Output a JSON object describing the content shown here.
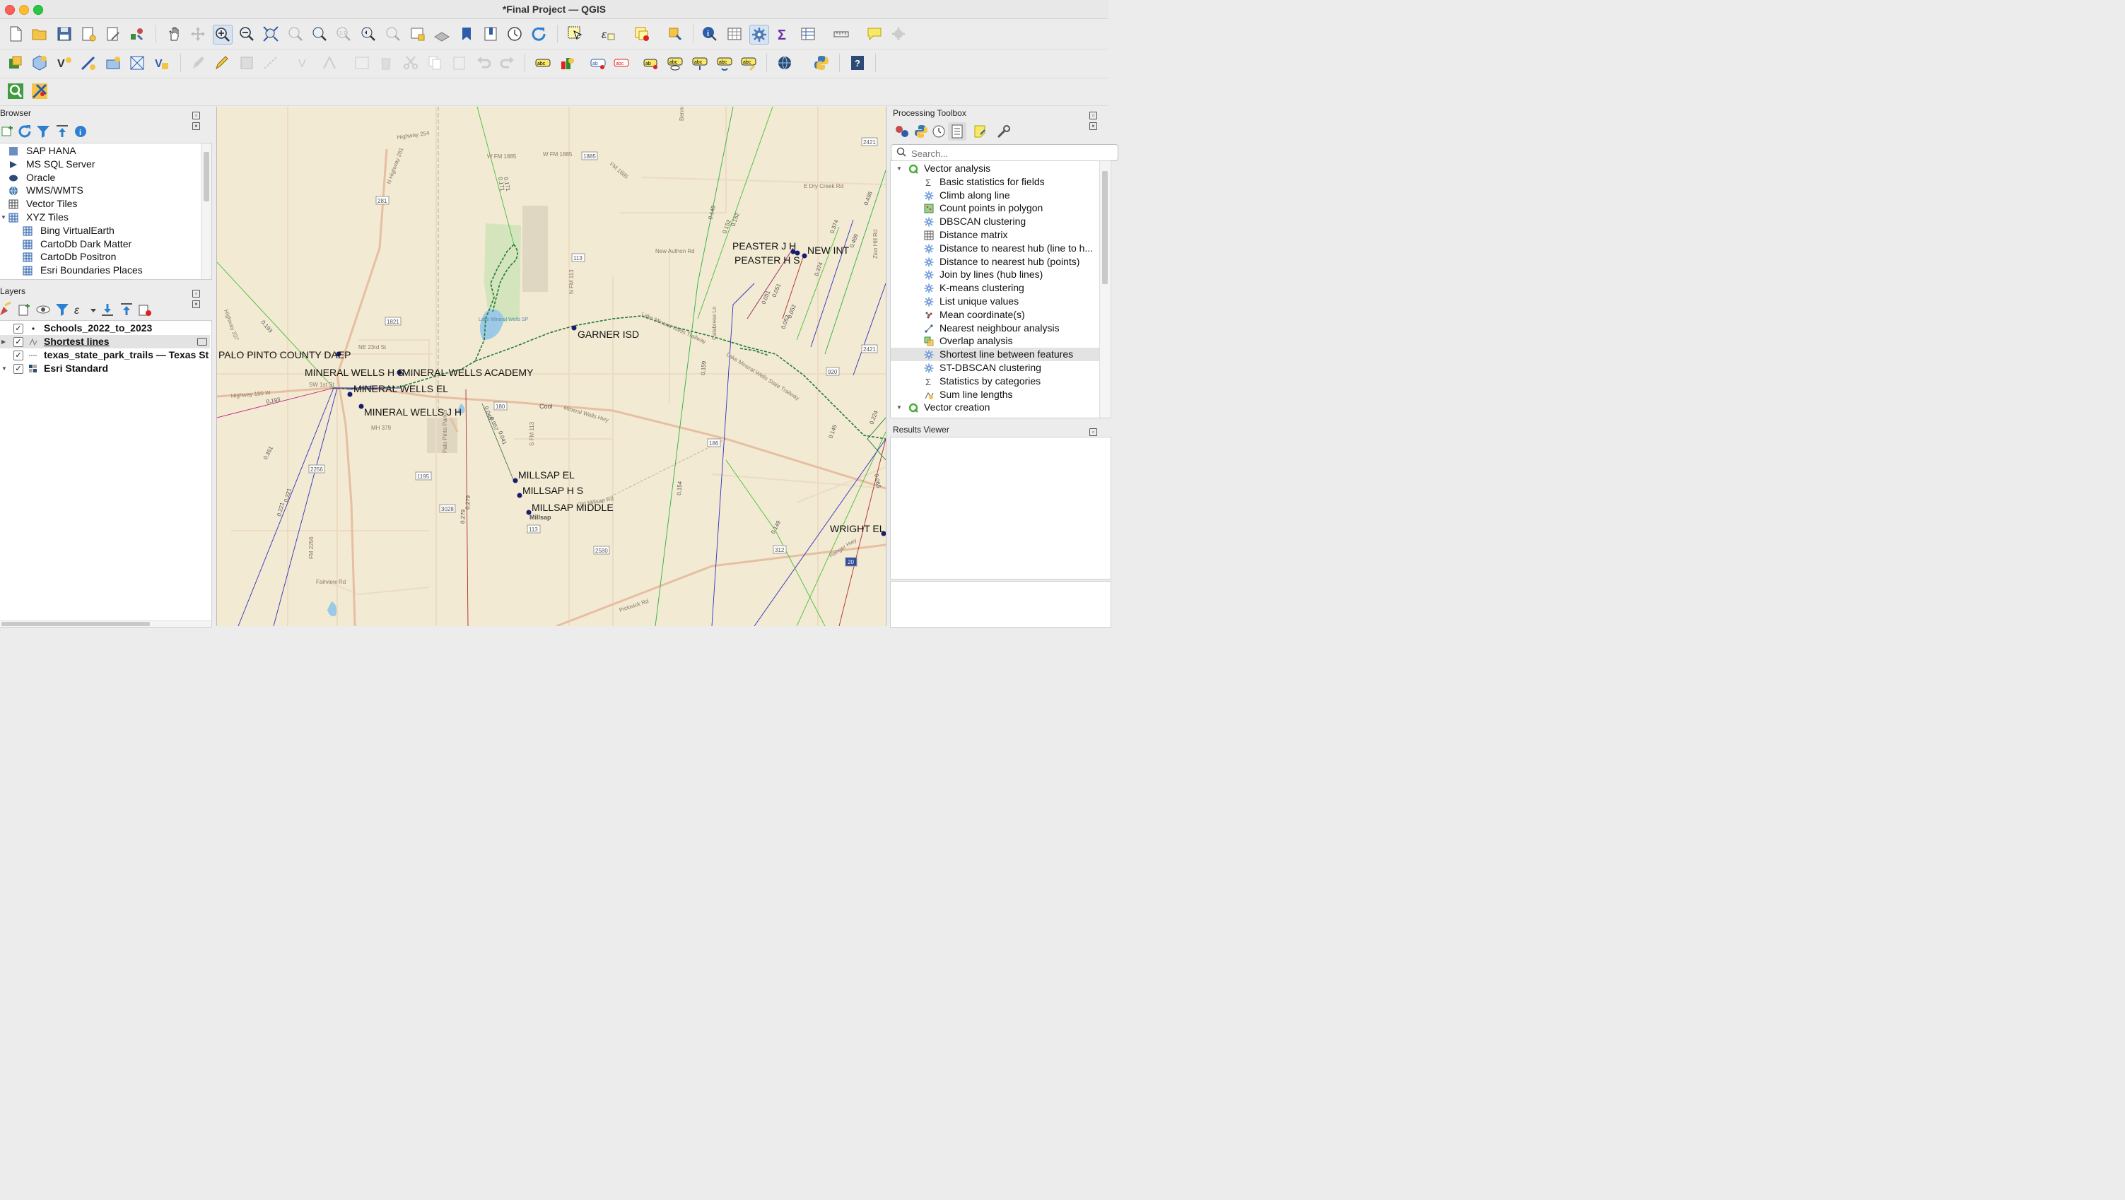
{
  "window": {
    "title": "*Final Project — QGIS"
  },
  "browser_panel": {
    "title": "Browser",
    "items": [
      {
        "label": "SAP HANA",
        "icon": "sap-hana-icon",
        "level": 0
      },
      {
        "label": "MS SQL Server",
        "icon": "mssql-icon",
        "level": 0
      },
      {
        "label": "Oracle",
        "icon": "oracle-icon",
        "level": 0
      },
      {
        "label": "WMS/WMTS",
        "icon": "globe-icon",
        "level": 0
      },
      {
        "label": "Vector Tiles",
        "icon": "vector-tiles-icon",
        "level": 0
      },
      {
        "label": "XYZ Tiles",
        "icon": "xyz-tiles-icon",
        "level": 0,
        "expanded": true
      },
      {
        "label": "Bing VirtualEarth",
        "icon": "xyz-tiles-icon",
        "level": 1
      },
      {
        "label": "CartoDb Dark Matter",
        "icon": "xyz-tiles-icon",
        "level": 1
      },
      {
        "label": "CartoDb Positron",
        "icon": "xyz-tiles-icon",
        "level": 1
      },
      {
        "label": "Esri Boundaries Places",
        "icon": "xyz-tiles-icon",
        "level": 1
      }
    ]
  },
  "layers_panel": {
    "title": "Layers",
    "layers": [
      {
        "name": "Schools_2022_to_2023",
        "checked": true,
        "bold": true,
        "icon": "point-layer-icon"
      },
      {
        "name": "Shortest lines",
        "checked": true,
        "bold": true,
        "underline": true,
        "selected": true,
        "icon": "line-layer-icon"
      },
      {
        "name": "texas_state_park_trails — Texas St",
        "checked": true,
        "bold": true,
        "icon": "dashed-line-layer-icon"
      },
      {
        "name": "Esri Standard",
        "checked": true,
        "bold": true,
        "icon": "raster-layer-icon"
      }
    ]
  },
  "processing_toolbox": {
    "title": "Processing Toolbox",
    "search_placeholder": "Search...",
    "groups": [
      {
        "label": "Vector analysis",
        "items": [
          {
            "label": "Basic statistics for fields",
            "icon": "sigma-icon"
          },
          {
            "label": "Climb along line",
            "icon": "gear-icon"
          },
          {
            "label": "Count points in polygon",
            "icon": "count-points-icon"
          },
          {
            "label": "DBSCAN clustering",
            "icon": "gear-icon"
          },
          {
            "label": "Distance matrix",
            "icon": "matrix-icon"
          },
          {
            "label": "Distance to nearest hub (line to h...",
            "icon": "gear-icon"
          },
          {
            "label": "Distance to nearest hub (points)",
            "icon": "gear-icon"
          },
          {
            "label": "Join by lines (hub lines)",
            "icon": "gear-icon"
          },
          {
            "label": "K-means clustering",
            "icon": "gear-icon"
          },
          {
            "label": "List unique values",
            "icon": "gear-icon"
          },
          {
            "label": "Mean coordinate(s)",
            "icon": "mean-coord-icon"
          },
          {
            "label": "Nearest neighbour analysis",
            "icon": "nearest-neighbour-icon"
          },
          {
            "label": "Overlap analysis",
            "icon": "overlap-icon"
          },
          {
            "label": "Shortest line between features",
            "icon": "gear-icon",
            "selected": true
          },
          {
            "label": "ST-DBSCAN clustering",
            "icon": "gear-icon"
          },
          {
            "label": "Statistics by categories",
            "icon": "sigma-icon"
          },
          {
            "label": "Sum line lengths",
            "icon": "sum-lines-icon"
          }
        ]
      },
      {
        "label": "Vector creation",
        "items": []
      }
    ]
  },
  "results_viewer": {
    "title": "Results Viewer"
  },
  "map": {
    "school_labels": [
      "PALO PINTO COUNTY DAEP",
      "MINERAL WELLS H S",
      "MINERAL WELLS ACADEMY",
      "MINERAL WELLS EL",
      "MINERAL WELLS J H",
      "GARNER ISD",
      "PEASTER J H",
      "PEASTER H S",
      "NEW INT",
      "MILLSAP EL",
      "MILLSAP H S",
      "MILLSAP MIDDLE",
      "WRIGHT EL"
    ],
    "road_labels": [
      "Highway 254",
      "W FM 1885",
      "W FM 1885",
      "FM 1885",
      "N Highway 281",
      "New Authon Rd",
      "E Dry Creek Rd",
      "N FM 113",
      "Lake Mineral Wells Trailway",
      "Lake Mineral Wells State Trailway",
      "Mineral Wells Hwy",
      "Cool",
      "S FM 113",
      "Old Millsap Rd",
      "Millsap",
      "Fairview Rd",
      "MH 379",
      "NE 23rd St",
      "SW 1st St",
      "Highway 180 W",
      "Lake Mineral Wells SP",
      "Highway 337",
      "Pickwick Rd",
      "Ranger Hwy",
      "Zion Hill Rd",
      "Bennett Rd",
      "Calabrese Ln",
      "FM 2256",
      "Palo Pinto Parker"
    ],
    "shield_labels": [
      "281",
      "1821",
      "180",
      "113",
      "1195",
      "3028",
      "2256",
      "113",
      "2580",
      "312",
      "20",
      "2421",
      "2421",
      "920",
      "1885",
      "186"
    ],
    "line_distance_labels": [
      "0.171",
      "0.171",
      "0.149",
      "0.152",
      "0.152",
      "0.374",
      "0.374",
      "0.193",
      "0.193",
      "0.361",
      "0.221",
      "0.221",
      "0.048",
      "0.057",
      "0.041",
      "0.279",
      "0.279",
      "0.159",
      "0.154",
      "0.149",
      "0.051",
      "0.051",
      "0.052",
      "0.052",
      "0.498",
      "0.489",
      "0.224",
      "0.065",
      "0.145"
    ]
  },
  "colors": {
    "map_background": "#f2ead2",
    "road_major": "#e0b79a",
    "road_minor": "#efdcc8",
    "trail": "#1f7a3c",
    "park": "#cfe3b8",
    "water": "#9cc9e6",
    "school_point": "#1a1a6e",
    "selected_row": "#e3e3e3"
  }
}
